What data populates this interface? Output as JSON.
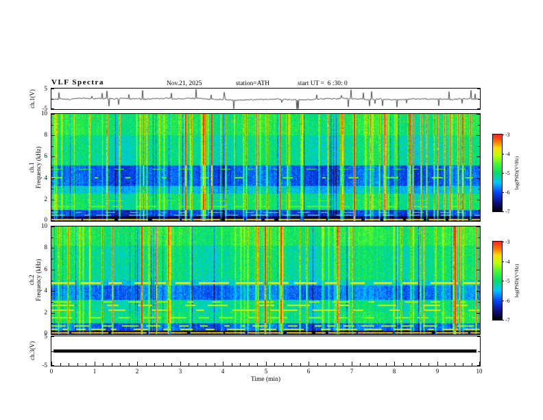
{
  "header": {
    "title": "VLF Spectra",
    "date": "Nov.21, 2025",
    "station": "station=ATH",
    "start_ut": "start UT =  6 :30: 0"
  },
  "xaxis": {
    "label": "Time (min)",
    "min": 0,
    "max": 10,
    "major_ticks": [
      0,
      1,
      2,
      3,
      4,
      5,
      6,
      7,
      8,
      9,
      10
    ],
    "minor_per_interval": 4
  },
  "colorbar": {
    "label": "log(PSD)(V²/Hz)",
    "min": -7,
    "max": -3,
    "ticks": [
      -3,
      -4,
      -5,
      -6,
      -7
    ],
    "colors_bottom_to_top": [
      "#000000",
      "#0000ff",
      "#00ffff",
      "#00e06e",
      "#46fa32",
      "#ffe000",
      "#ff7800",
      "#ff2323"
    ]
  },
  "chart_data": [
    {
      "panel": "ch1_waveform",
      "type": "line",
      "ylabel": "ch.1(V)",
      "ylim": [
        -5,
        5
      ],
      "yticks": [
        5,
        -5
      ],
      "ytick_labels": [
        "5",
        "-5"
      ],
      "x_range_min": [
        0,
        10
      ],
      "description": "Broadband VLF time series: ~±0.8 V noise floor with dense impulsive sferic spikes reaching ±5 V across the full 10 minutes",
      "noise_v": 0.32,
      "spike_prob": 0.06,
      "spike_v": [
        1.2,
        4.4
      ],
      "seed": 7
    },
    {
      "panel": "ch1_spectrogram",
      "type": "heatmap",
      "ylabel_lines": [
        "ch.1",
        "Frequency (kHz)"
      ],
      "ylim": [
        0,
        10
      ],
      "yticks": [
        0,
        2,
        4,
        6,
        8,
        10
      ],
      "zlabel": "log(PSD)(V²/Hz)",
      "zlim": [
        -7,
        -3
      ],
      "seed": 101,
      "stripe_prob": 0.1,
      "description": "0-10 kHz spectrogram, 10 min: green background (~-5) with dense broadband vertical sferic stripes, blue low-power band 3.3-5.2 kHz, near-black band below 0.45 kHz with bright red hum lines, yellower speckle above 8 kHz",
      "bands": [
        {
          "f": [
            0,
            0.45
          ],
          "level": -6.8
        },
        {
          "f": [
            0.45,
            1.05
          ],
          "level": -6.1
        },
        {
          "f": [
            1.05,
            2.55
          ],
          "level": -5.0
        },
        {
          "f": [
            2.55,
            3.3
          ],
          "level": -5.45
        },
        {
          "f": [
            3.3,
            5.2
          ],
          "level": -5.95
        },
        {
          "f": [
            5.2,
            8.0
          ],
          "level": -5.1
        },
        {
          "f": [
            8.0,
            10.01
          ],
          "level": -4.85
        }
      ],
      "lines": [
        {
          "f": 0.15,
          "hw": 0.07,
          "level": -3.7,
          "duty": 0.85,
          "dash": 30
        },
        {
          "f": 0.55,
          "hw": 0.05,
          "level": -4.1,
          "duty": 0.45,
          "dash": 18
        },
        {
          "f": 0.8,
          "hw": 0.05,
          "level": -4.3,
          "duty": 0.35,
          "dash": 14
        },
        {
          "f": 1.35,
          "hw": 0.06,
          "level": -4.5,
          "duty": 0.5,
          "dash": 22
        },
        {
          "f": 1.9,
          "hw": 0.05,
          "level": -4.6,
          "duty": 0.4,
          "dash": 18
        },
        {
          "f": 4.05,
          "hw": 0.05,
          "level": -4.4,
          "duty": 0.25,
          "dash": 12
        },
        {
          "f": 4.85,
          "hw": 0.05,
          "level": -4.5,
          "duty": 0.3,
          "dash": 12
        }
      ]
    },
    {
      "panel": "ch2_spectrogram",
      "type": "heatmap",
      "ylabel_lines": [
        "ch.2",
        "Frequency (kHz)"
      ],
      "ylim": [
        0,
        10
      ],
      "yticks": [
        0,
        2,
        4,
        6,
        8,
        10
      ],
      "zlabel": "log(PSD)(V²/Hz)",
      "zlim": [
        -7,
        -3
      ],
      "seed": 202,
      "stripe_prob": 0.1,
      "description": "0-10 kHz spectrogram, 10 min: similar to ch.1 but with strong intermittent orange/red horizontal streaks near 2.2-3.0 kHz, a bright dashed orange line near 4.75 kHz, blue band 3.2-4.5 kHz, black band with red hum lines below 0.35 kHz",
      "bands": [
        {
          "f": [
            0,
            0.35
          ],
          "level": -6.8
        },
        {
          "f": [
            0.35,
            1.0
          ],
          "level": -5.9
        },
        {
          "f": [
            1.0,
            2.1
          ],
          "level": -4.95
        },
        {
          "f": [
            2.1,
            3.2
          ],
          "level": -5.1
        },
        {
          "f": [
            3.2,
            4.5
          ],
          "level": -5.8
        },
        {
          "f": [
            4.5,
            5.0
          ],
          "level": -5.3
        },
        {
          "f": [
            5.0,
            8.2
          ],
          "level": -5.05
        },
        {
          "f": [
            8.2,
            10.01
          ],
          "level": -4.8
        }
      ],
      "lines": [
        {
          "f": 0.12,
          "hw": 0.07,
          "level": -3.6,
          "duty": 0.9,
          "dash": 34
        },
        {
          "f": 0.45,
          "hw": 0.06,
          "level": -4.0,
          "duty": 0.55,
          "dash": 20
        },
        {
          "f": 0.75,
          "hw": 0.05,
          "level": -4.2,
          "duty": 0.45,
          "dash": 16
        },
        {
          "f": 1.55,
          "hw": 0.06,
          "level": -4.2,
          "duty": 0.5,
          "dash": 20
        },
        {
          "f": 2.25,
          "hw": 0.07,
          "level": -3.9,
          "duty": 0.45,
          "dash": 26
        },
        {
          "f": 2.65,
          "hw": 0.06,
          "level": -4.0,
          "duty": 0.4,
          "dash": 22
        },
        {
          "f": 3.0,
          "hw": 0.05,
          "level": -4.2,
          "duty": 0.35,
          "dash": 18
        },
        {
          "f": 4.75,
          "hw": 0.08,
          "level": -3.8,
          "duty": 0.7,
          "dash": 30
        }
      ]
    },
    {
      "panel": "ch3_waveform",
      "type": "line",
      "ylabel": "ch.3(V)",
      "ylim": [
        -5,
        5
      ],
      "yticks": [
        5,
        -5
      ],
      "ytick_labels": [
        "5",
        "-5"
      ],
      "value": 0,
      "description": "Flat (dead/zero) channel drawn as a thick solid black line at 0 V for the whole record"
    }
  ]
}
